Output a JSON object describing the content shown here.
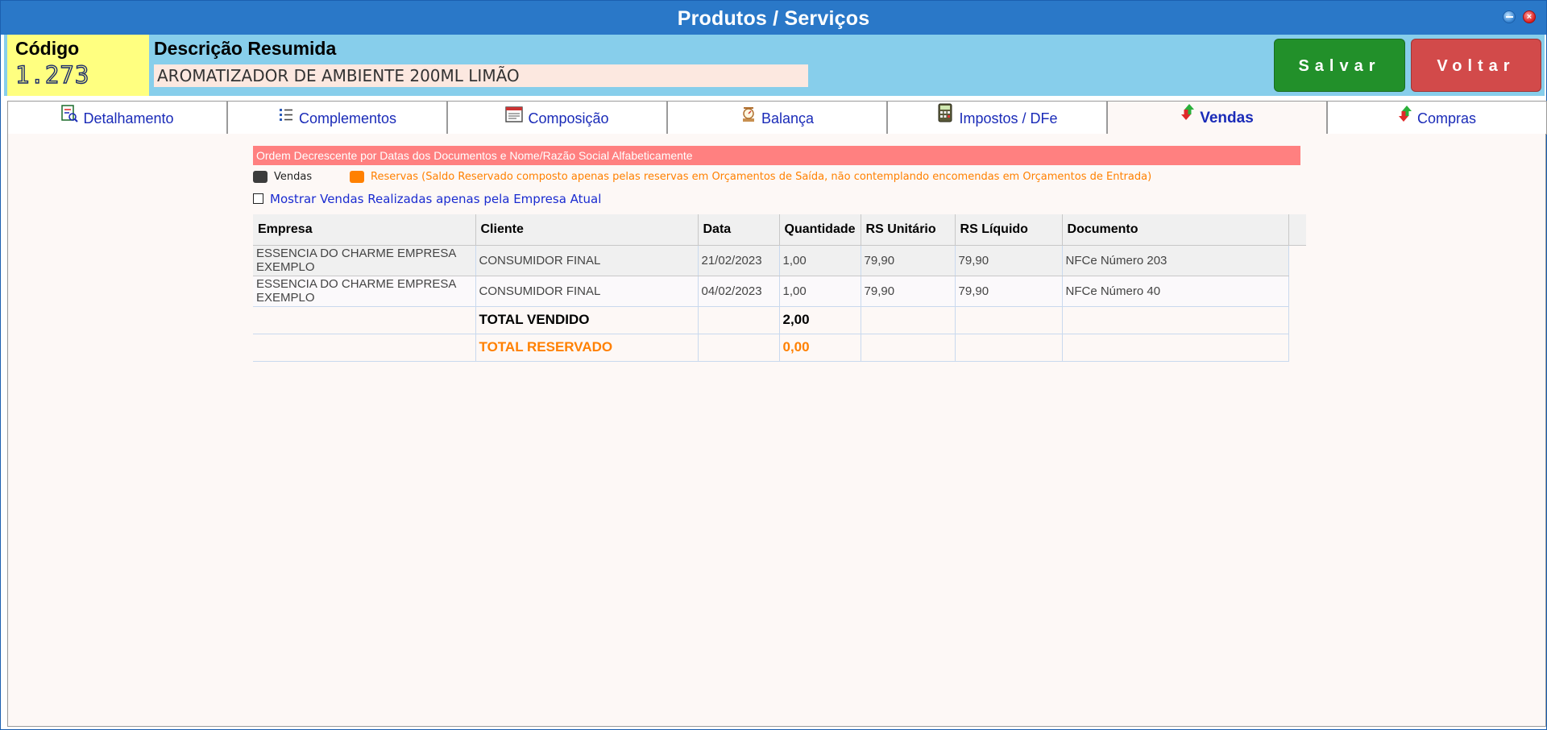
{
  "window": {
    "title": "Produtos / Serviços"
  },
  "header": {
    "codigo_label": "Código",
    "codigo_value": "1.273",
    "descricao_label": "Descrição Resumida",
    "descricao_value": "AROMATIZADOR DE AMBIENTE 200ML LIMÃO",
    "salvar_label": "Salvar",
    "voltar_label": "Voltar"
  },
  "tabs": [
    {
      "label": "Detalhamento",
      "icon": "document-search-icon"
    },
    {
      "label": "Complementos",
      "icon": "list-icon"
    },
    {
      "label": "Composição",
      "icon": "form-icon"
    },
    {
      "label": "Balança",
      "icon": "scale-icon"
    },
    {
      "label": "Impostos / DFe",
      "icon": "calculator-icon"
    },
    {
      "label": "Vendas",
      "icon": "up-down-arrows-icon",
      "active": true
    },
    {
      "label": "Compras",
      "icon": "up-down-arrows-icon"
    }
  ],
  "vendas": {
    "banner": "Ordem Decrescente por Datas dos Documentos e Nome/Razão Social Alfabeticamente",
    "legend": [
      {
        "label": "Vendas",
        "color": "#3c3c3c",
        "text_color": "#222222"
      },
      {
        "label": "Reservas (Saldo Reservado composto apenas pelas reservas em Orçamentos de Saída, não contemplando encomendas em Orçamentos de Entrada)",
        "color": "#ff8000",
        "text_color": "#ff8000"
      }
    ],
    "filter_checkbox": {
      "label": "Mostrar Vendas Realizadas apenas pela Empresa Atual",
      "checked": false
    },
    "columns": [
      "Empresa",
      "Cliente",
      "Data",
      "Quantidade",
      "RS Unitário",
      "RS Líquido",
      "Documento"
    ],
    "rows": [
      [
        "ESSENCIA DO CHARME EMPRESA EXEMPLO",
        "CONSUMIDOR FINAL",
        "21/02/2023",
        "1,00",
        "79,90",
        "79,90",
        "NFCe Número 203"
      ],
      [
        "ESSENCIA DO CHARME EMPRESA EXEMPLO",
        "CONSUMIDOR FINAL",
        "04/02/2023",
        "1,00",
        "79,90",
        "79,90",
        "NFCe Número 40"
      ]
    ],
    "totals": {
      "vendido_label": "TOTAL VENDIDO",
      "vendido_value": "2,00",
      "reservado_label": "TOTAL RESERVADO",
      "reservado_value": "0,00"
    }
  },
  "colors": {
    "titlebar": "#2a78c8",
    "header_bg": "#87ceeb",
    "codigo_bg": "#ffff80",
    "salvar": "#22902a",
    "voltar": "#d24a4a",
    "banner": "#ff8080",
    "tab_text": "#1a2bb8",
    "reserved": "#ff8000"
  }
}
